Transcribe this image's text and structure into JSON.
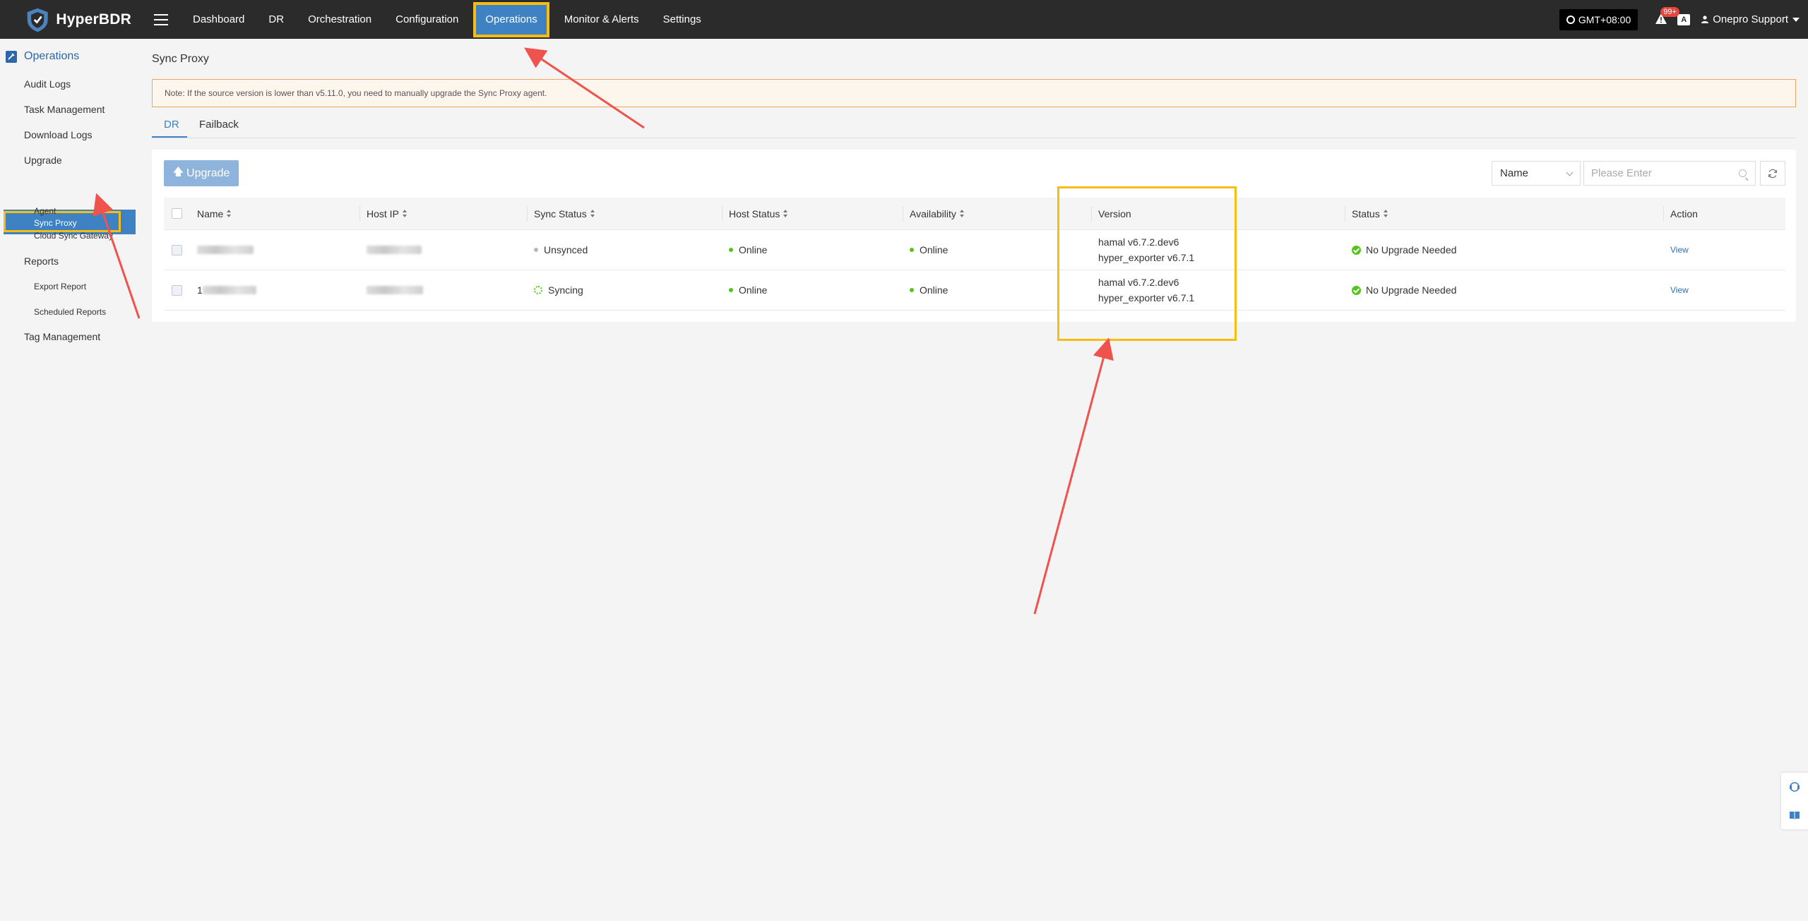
{
  "app": {
    "name": "HyperBDR"
  },
  "topnav": {
    "items": [
      "Dashboard",
      "DR",
      "Orchestration",
      "Configuration",
      "Operations",
      "Monitor & Alerts",
      "Settings"
    ],
    "active_index": 4
  },
  "topright": {
    "timezone": "GMT+08:00",
    "alert_badge": "99+",
    "lang_label": "A",
    "user": "Onepro Support"
  },
  "sidebar": {
    "section": "Operations",
    "items": [
      {
        "label": "Audit Logs"
      },
      {
        "label": "Task Management"
      },
      {
        "label": "Download Logs"
      },
      {
        "label": "Upgrade"
      },
      {
        "label": "Sync Proxy"
      },
      {
        "label": "Agent"
      },
      {
        "label": "Cloud Sync Gateway"
      },
      {
        "label": "Reports"
      },
      {
        "label": "Export Report"
      },
      {
        "label": "Scheduled Reports"
      },
      {
        "label": "Tag Management"
      }
    ],
    "active": "Sync Proxy"
  },
  "page": {
    "title": "Sync Proxy",
    "note": "Note: If the source version is lower than v5.11.0, you need to manually upgrade the Sync Proxy agent.",
    "tabs": [
      "DR",
      "Failback"
    ],
    "active_tab": "DR"
  },
  "toolbar": {
    "upgrade_label": "Upgrade",
    "filter_field": "Name",
    "search_placeholder": "Please Enter"
  },
  "table": {
    "columns": [
      "Name",
      "Host IP",
      "Sync Status",
      "Host Status",
      "Availability",
      "Version",
      "Status",
      "Action"
    ],
    "rows": [
      {
        "name_visible": "",
        "sync_status": "Unsynced",
        "host_status": "Online",
        "availability": "Online",
        "version_line1": "hamal v6.7.2.dev6",
        "version_line2": "hyper_exporter v6.7.1",
        "status": "No Upgrade Needed",
        "action": "View"
      },
      {
        "name_visible": "1",
        "sync_status": "Syncing",
        "host_status": "Online",
        "availability": "Online",
        "version_line1": "hamal v6.7.2.dev6",
        "version_line2": "hyper_exporter v6.7.1",
        "status": "No Upgrade Needed",
        "action": "View"
      }
    ]
  },
  "colors": {
    "topbar": "#2b2b2b",
    "accent": "#3e82c4",
    "highlight": "#f7bd12",
    "annotation_arrow": "#f0524d",
    "online": "#52c41a"
  }
}
